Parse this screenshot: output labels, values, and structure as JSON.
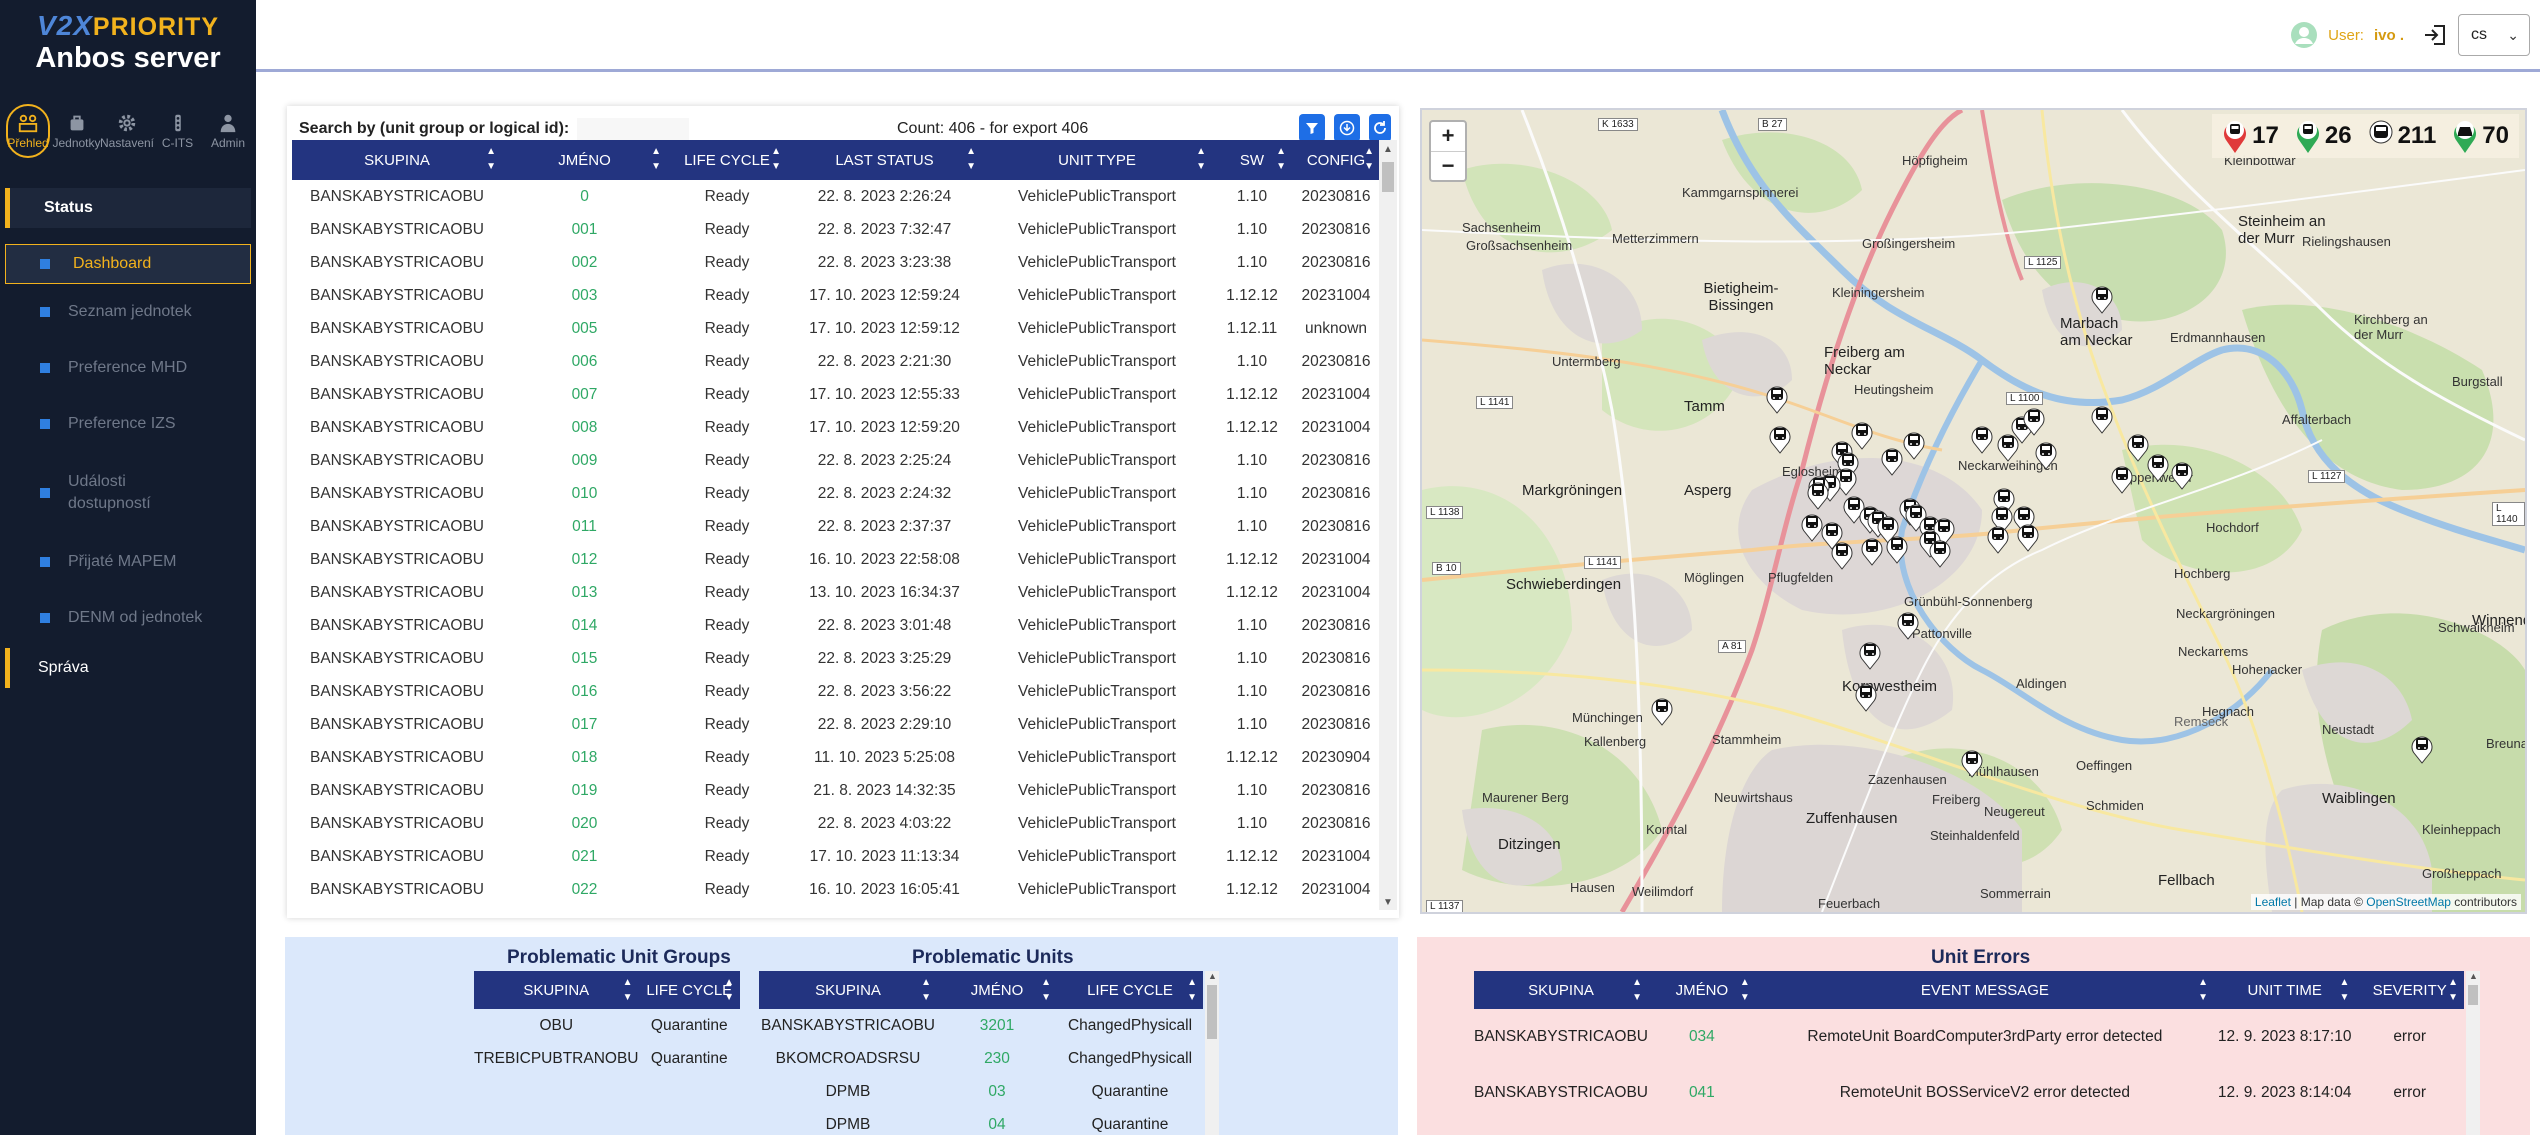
{
  "brand": {
    "v2x": "V2X",
    "priority": "PRIORITY",
    "subtitle": "Anbos server"
  },
  "top_nav": [
    {
      "label": "Přehled",
      "icon": "overview-icon"
    },
    {
      "label": "Jednotky",
      "icon": "units-icon"
    },
    {
      "label": "Nastavení",
      "icon": "gear-icon"
    },
    {
      "label": "C-ITS",
      "icon": "cits-icon"
    },
    {
      "label": "Admin",
      "icon": "admin-icon"
    }
  ],
  "side_menu": {
    "status_label": "Status",
    "items": [
      "Dashboard",
      "Seznam jednotek",
      "Preference MHD",
      "Preference IZS",
      "Události dostupností",
      "Přijaté MAPEM",
      "DENM od jednotek"
    ],
    "sprava_label": "Správa"
  },
  "header": {
    "user_label": "User:",
    "user_name": "ivo .",
    "lang": "cs"
  },
  "units": {
    "search_label": "Search by (unit group or logical id):",
    "search_value": "",
    "count_text": "Count: 406 - for export 406",
    "columns": [
      "SKUPINA",
      "JMÉNO",
      "LIFE CYCLE",
      "LAST STATUS",
      "UNIT TYPE",
      "SW",
      "CONFIG"
    ],
    "rows": [
      [
        "BANSKABYSTRICAOBU",
        "0",
        "Ready",
        "22. 8. 2023 2:26:24",
        "VehiclePublicTransport",
        "1.10",
        "20230816"
      ],
      [
        "BANSKABYSTRICAOBU",
        "001",
        "Ready",
        "22. 8. 2023 7:32:47",
        "VehiclePublicTransport",
        "1.10",
        "20230816"
      ],
      [
        "BANSKABYSTRICAOBU",
        "002",
        "Ready",
        "22. 8. 2023 3:23:38",
        "VehiclePublicTransport",
        "1.10",
        "20230816"
      ],
      [
        "BANSKABYSTRICAOBU",
        "003",
        "Ready",
        "17. 10. 2023 12:59:24",
        "VehiclePublicTransport",
        "1.12.12",
        "20231004"
      ],
      [
        "BANSKABYSTRICAOBU",
        "005",
        "Ready",
        "17. 10. 2023 12:59:12",
        "VehiclePublicTransport",
        "1.12.11",
        "unknown"
      ],
      [
        "BANSKABYSTRICAOBU",
        "006",
        "Ready",
        "22. 8. 2023 2:21:30",
        "VehiclePublicTransport",
        "1.10",
        "20230816"
      ],
      [
        "BANSKABYSTRICAOBU",
        "007",
        "Ready",
        "17. 10. 2023 12:55:33",
        "VehiclePublicTransport",
        "1.12.12",
        "20231004"
      ],
      [
        "BANSKABYSTRICAOBU",
        "008",
        "Ready",
        "17. 10. 2023 12:59:20",
        "VehiclePublicTransport",
        "1.12.12",
        "20231004"
      ],
      [
        "BANSKABYSTRICAOBU",
        "009",
        "Ready",
        "22. 8. 2023 2:25:24",
        "VehiclePublicTransport",
        "1.10",
        "20230816"
      ],
      [
        "BANSKABYSTRICAOBU",
        "010",
        "Ready",
        "22. 8. 2023 2:24:32",
        "VehiclePublicTransport",
        "1.10",
        "20230816"
      ],
      [
        "BANSKABYSTRICAOBU",
        "011",
        "Ready",
        "22. 8. 2023 2:37:37",
        "VehiclePublicTransport",
        "1.10",
        "20230816"
      ],
      [
        "BANSKABYSTRICAOBU",
        "012",
        "Ready",
        "16. 10. 2023 22:58:08",
        "VehiclePublicTransport",
        "1.12.12",
        "20231004"
      ],
      [
        "BANSKABYSTRICAOBU",
        "013",
        "Ready",
        "13. 10. 2023 16:34:37",
        "VehiclePublicTransport",
        "1.12.12",
        "20231004"
      ],
      [
        "BANSKABYSTRICAOBU",
        "014",
        "Ready",
        "22. 8. 2023 3:01:48",
        "VehiclePublicTransport",
        "1.10",
        "20230816"
      ],
      [
        "BANSKABYSTRICAOBU",
        "015",
        "Ready",
        "22. 8. 2023 3:25:29",
        "VehiclePublicTransport",
        "1.10",
        "20230816"
      ],
      [
        "BANSKABYSTRICAOBU",
        "016",
        "Ready",
        "22. 8. 2023 3:56:22",
        "VehiclePublicTransport",
        "1.10",
        "20230816"
      ],
      [
        "BANSKABYSTRICAOBU",
        "017",
        "Ready",
        "22. 8. 2023 2:29:10",
        "VehiclePublicTransport",
        "1.10",
        "20230816"
      ],
      [
        "BANSKABYSTRICAOBU",
        "018",
        "Ready",
        "11. 10. 2023 5:25:08",
        "VehiclePublicTransport",
        "1.12.12",
        "20230904"
      ],
      [
        "BANSKABYSTRICAOBU",
        "019",
        "Ready",
        "21. 8. 2023 14:32:35",
        "VehiclePublicTransport",
        "1.10",
        "20230816"
      ],
      [
        "BANSKABYSTRICAOBU",
        "020",
        "Ready",
        "22. 8. 2023 4:03:22",
        "VehiclePublicTransport",
        "1.10",
        "20230816"
      ],
      [
        "BANSKABYSTRICAOBU",
        "021",
        "Ready",
        "17. 10. 2023 11:13:34",
        "VehiclePublicTransport",
        "1.12.12",
        "20231004"
      ],
      [
        "BANSKABYSTRICAOBU",
        "022",
        "Ready",
        "16. 10. 2023 16:05:41",
        "VehiclePublicTransport",
        "1.12.12",
        "20231004"
      ]
    ]
  },
  "map": {
    "stats": [
      {
        "value": "17",
        "color": "#e03a3a"
      },
      {
        "value": "26",
        "color": "#2faa55"
      },
      {
        "value": "211",
        "color": "#333333"
      },
      {
        "value": "70",
        "color": "#2faa55"
      }
    ],
    "places": [
      "Sachsenheim",
      "Großsachsenheim",
      "Kammgarnspinnerei",
      "Metterzimmern",
      "Höpfigheim",
      "Kleinbottwar",
      "Steinheim an der Murr",
      "Großingersheim",
      "Kleiningersheim",
      "Bietigheim-Bissingen",
      "Untermberg",
      "Freiberg am Neckar",
      "Heutingsheim",
      "Marbach am Neckar",
      "Erdmannhausen",
      "Affalterbach",
      "Tamm",
      "Asperg",
      "Markgröningen",
      "Eglosheim",
      "Neckarweihingen",
      "Poppenweiler",
      "Hochdorf",
      "Möglingen",
      "Pflugfelden",
      "Grünbühl-Sonnenberg",
      "Neckargröningen",
      "Hochberg",
      "Schwieberdingen",
      "Pattonville",
      "Kornwestheim",
      "Aldingen",
      "Remseck",
      "Neckarrems",
      "Hohenacker",
      "Münchingen",
      "Kallenberg",
      "Stammheim",
      "Neuwirtshaus",
      "Zazenhausen",
      "Mühlhausen",
      "Oeffingen",
      "Waiblingen",
      "Maurener Berg",
      "Zuffenhausen",
      "Freiberg",
      "Neugereut",
      "Schmiden",
      "Korntal",
      "Steinhaldenfeld",
      "Ditzingen",
      "Hausen",
      "Weilimdorf",
      "Feuerbach",
      "Sommerrain",
      "Fellbach",
      "Winnende",
      "Schwaikheim",
      "Neustadt",
      "Hegnach",
      "Breuna",
      "Kleinheppach",
      "Großheppach",
      "Burgstall",
      "Kirchberg an der Murr",
      "Rielingshausen"
    ],
    "roads": [
      "K 1633",
      "B 27",
      "L 1125",
      "L 1141",
      "L 1100",
      "L 1138",
      "B 10",
      "L 1141",
      "A 81",
      "L 1127",
      "L 1137",
      "L 1140"
    ],
    "attribution": {
      "leaflet": "Leaflet",
      "mid": " | Map data © ",
      "osm": "OpenStreetMap",
      "tail": " contributors"
    }
  },
  "problematic_groups": {
    "title": "Problematic Unit Groups",
    "columns": [
      "SKUPINA",
      "LIFE CYCLE"
    ],
    "rows": [
      [
        "OBU",
        "Quarantine"
      ],
      [
        "TREBICPUBTRANOBU",
        "Quarantine"
      ]
    ]
  },
  "problematic_units": {
    "title": "Problematic Units",
    "columns": [
      "SKUPINA",
      "JMÉNO",
      "LIFE CYCLE"
    ],
    "rows": [
      [
        "BANSKABYSTRICAOBU",
        "3201",
        "ChangedPhysicall"
      ],
      [
        "BKOMCROADSRSU",
        "230",
        "ChangedPhysicall"
      ],
      [
        "DPMB",
        "03",
        "Quarantine"
      ],
      [
        "DPMB",
        "04",
        "Quarantine"
      ]
    ]
  },
  "unit_errors": {
    "title": "Unit Errors",
    "columns": [
      "SKUPINA",
      "JMÉNO",
      "EVENT MESSAGE",
      "UNIT TIME",
      "SEVERITY"
    ],
    "rows": [
      [
        "BANSKABYSTRICAOBU",
        "034",
        "RemoteUnit BoardComputer3rdParty error detected",
        "12. 9. 2023 8:17:10",
        "error"
      ],
      [
        "BANSKABYSTRICAOBU",
        "041",
        "RemoteUnit BOSServiceV2 error detected",
        "12. 9. 2023 8:14:04",
        "error"
      ]
    ]
  }
}
